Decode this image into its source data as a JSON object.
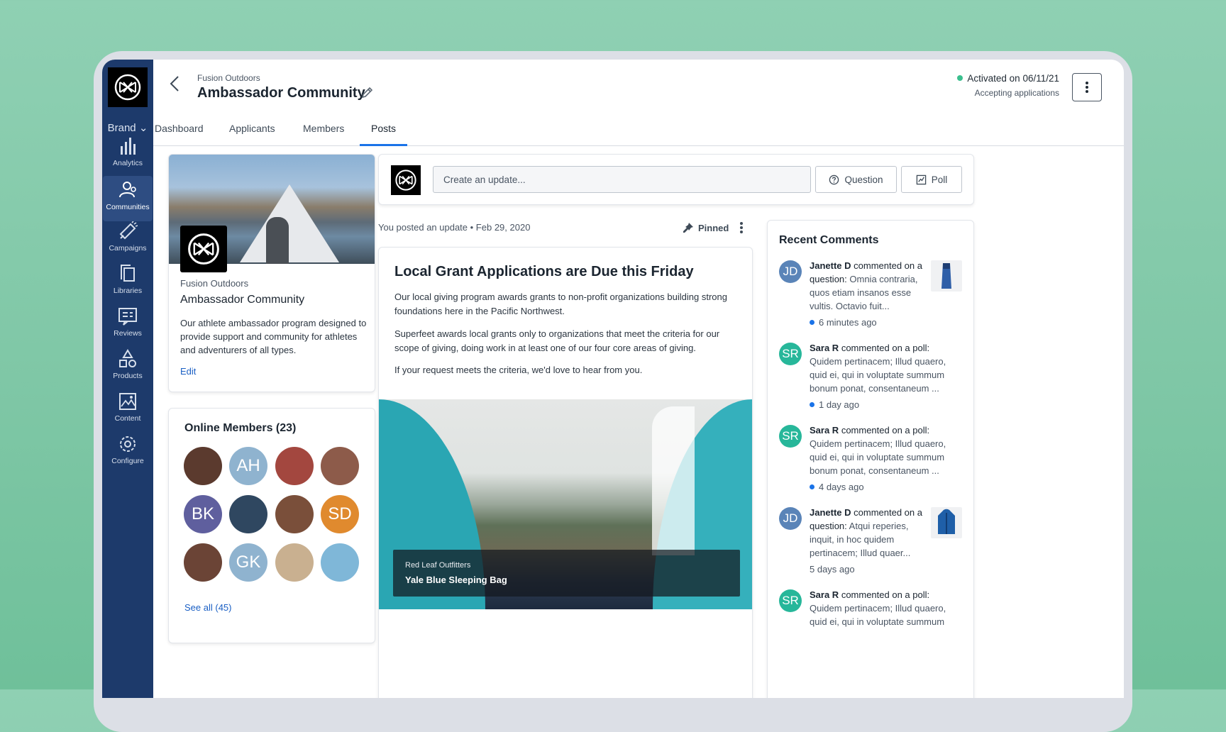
{
  "sidebar": {
    "brand_label": "Brand",
    "items": [
      {
        "label": "Analytics",
        "icon": "bar-chart-icon"
      },
      {
        "label": "Communities",
        "icon": "people-icon",
        "active": true
      },
      {
        "label": "Campaigns",
        "icon": "megaphone-icon"
      },
      {
        "label": "Libraries",
        "icon": "stack-icon"
      },
      {
        "label": "Reviews",
        "icon": "review-icon"
      },
      {
        "label": "Products",
        "icon": "shapes-icon"
      },
      {
        "label": "Content",
        "icon": "image-icon"
      },
      {
        "label": "Configure",
        "icon": "gear-icon"
      }
    ]
  },
  "header": {
    "org": "Fusion Outdoors",
    "title": "Ambassador Community",
    "status": "Activated on 06/11/21",
    "status_sub": "Accepting applications",
    "status_color": "#3bbf8e"
  },
  "tabs": [
    {
      "label": "Dashboard"
    },
    {
      "label": "Applicants"
    },
    {
      "label": "Members"
    },
    {
      "label": "Posts",
      "active": true
    }
  ],
  "profile": {
    "org": "Fusion Outdoors",
    "name": "Ambassador Community",
    "description": "Our athlete ambassador program designed to provide support and community for athletes and adventurers of all types.",
    "edit": "Edit"
  },
  "online_members": {
    "title": "Online Members (23)",
    "see_all": "See all (45)",
    "avatars": [
      {
        "initials": "",
        "color": "#5b3a2e"
      },
      {
        "initials": "AH",
        "color": "#8fb3cf"
      },
      {
        "initials": "",
        "color": "#a3473f"
      },
      {
        "initials": "",
        "color": "#8d5b4a"
      },
      {
        "initials": "BK",
        "color": "#5f5f9e"
      },
      {
        "initials": "",
        "color": "#2f4760"
      },
      {
        "initials": "",
        "color": "#7a4f3a"
      },
      {
        "initials": "SD",
        "color": "#e08a2e"
      },
      {
        "initials": "",
        "color": "#6b4436"
      },
      {
        "initials": "GK",
        "color": "#8fb3cf"
      },
      {
        "initials": "",
        "color": "#c9b090"
      },
      {
        "initials": "",
        "color": "#7fb7d8"
      }
    ]
  },
  "composer": {
    "placeholder": "Create an update...",
    "question": "Question",
    "poll": "Poll"
  },
  "post": {
    "meta": "You posted an update  •  Feb 29, 2020",
    "pinned": "Pinned",
    "title": "Local Grant Applications are Due this Friday",
    "p1": "Our local giving program awards grants to non-profit organizations building strong foundations here in the Pacific Northwest.",
    "p2": "Superfeet awards local grants only to organizations that meet the criteria for our scope of giving, doing work in at least one of our four core areas of giving.",
    "p3": "If your request meets the criteria, we'd love to hear from you.",
    "image_caption_small": "Red Leaf Outfitters",
    "image_caption_big": "Yale Blue Sleeping Bag"
  },
  "recent_comments": {
    "title": "Recent Comments",
    "items": [
      {
        "initials": "JD",
        "color": "#5a84b8",
        "name": "Janette D",
        "action": " commented on a question:",
        "text": "Omnia contraria, quos etiam insanos esse vultis. Octavio fuit...",
        "time": "6 minutes ago",
        "new": true,
        "thumb": true
      },
      {
        "initials": "SR",
        "color": "#27b79a",
        "name": "Sara R",
        "action": " commented on a poll:",
        "text": "Quidem pertinacem; Illud quaero, quid ei, qui in voluptate summum bonum ponat, consentaneum ...",
        "time": "1 day ago",
        "new": true
      },
      {
        "initials": "SR",
        "color": "#27b79a",
        "name": "Sara R",
        "action": " commented on a poll:",
        "text": "Quidem pertinacem; Illud quaero, quid ei, qui in voluptate summum bonum ponat, consentaneum ...",
        "time": "4 days ago",
        "new": true
      },
      {
        "initials": "JD",
        "color": "#5a84b8",
        "name": "Janette D",
        "action": " commented on a question:",
        "text": "Atqui reperies, inquit, in hoc quidem pertinacem; Illud quaer...",
        "time": "5 days ago",
        "new": false,
        "thumb": true
      },
      {
        "initials": "SR",
        "color": "#27b79a",
        "name": "Sara R",
        "action": " commented on a poll:",
        "text": "Quidem pertinacem; Illud quaero, quid ei, qui in voluptate summum",
        "time": "",
        "new": false
      }
    ]
  }
}
